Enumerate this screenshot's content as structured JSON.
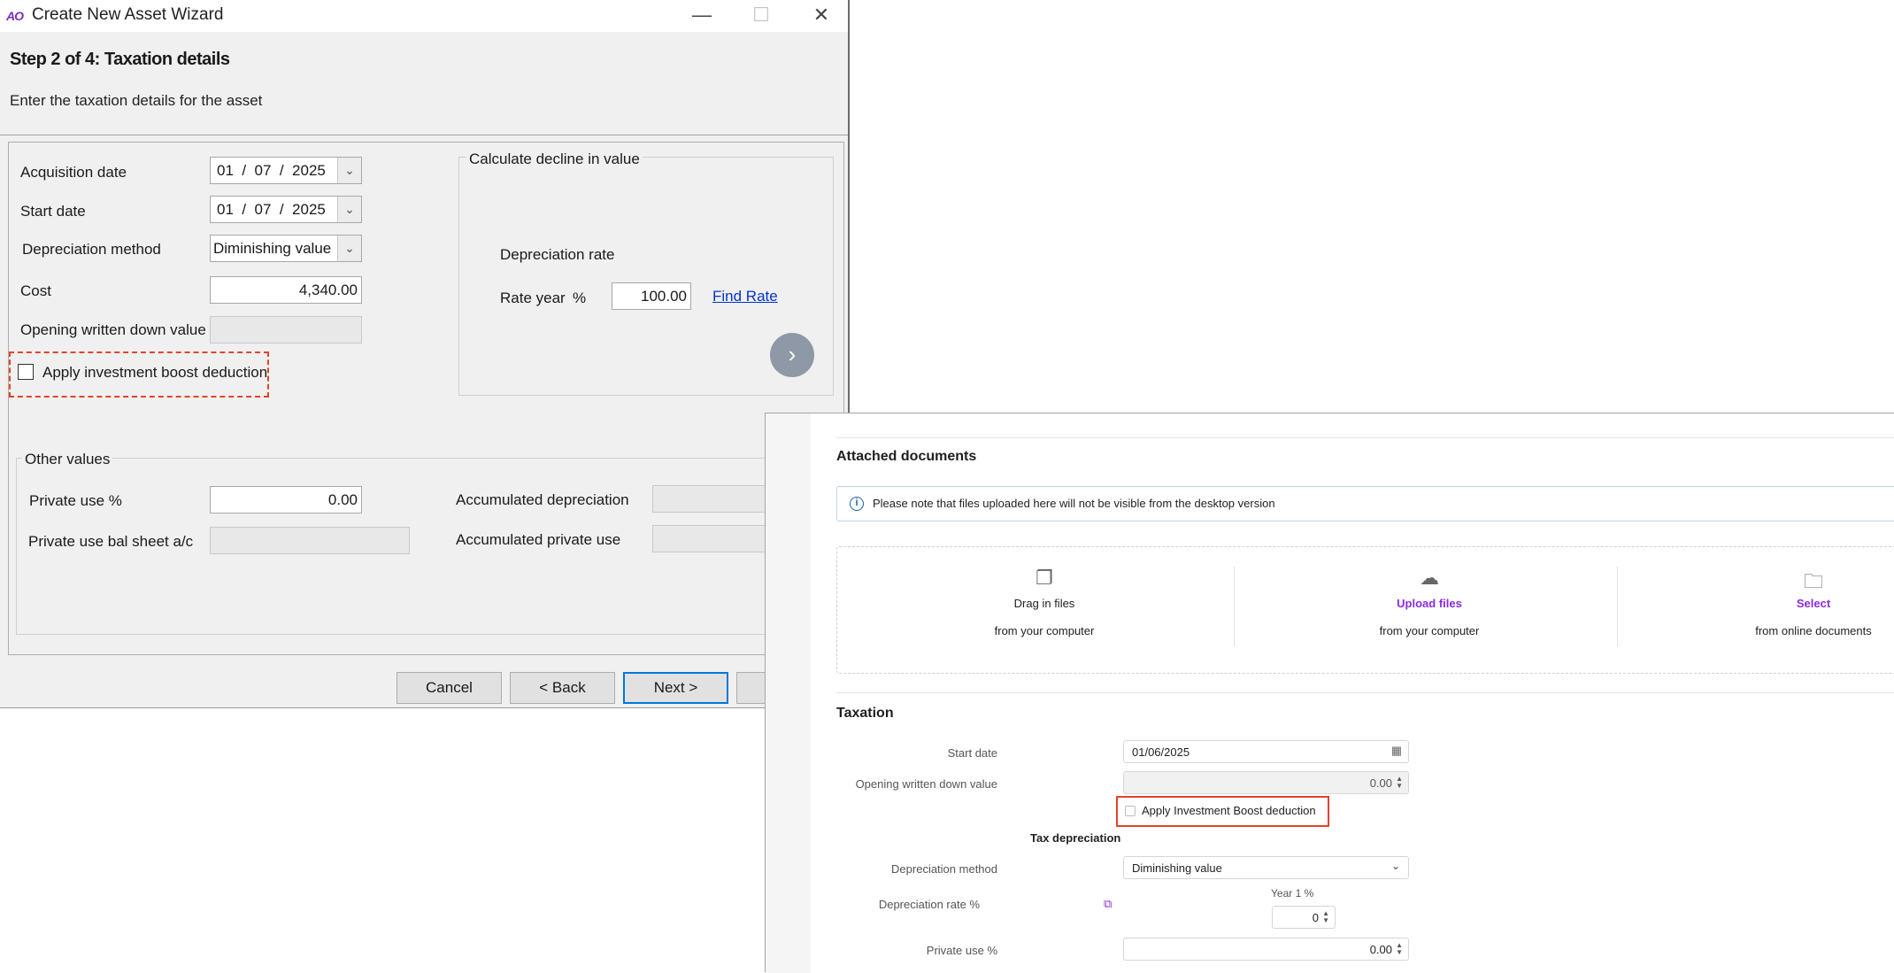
{
  "wizard": {
    "window_title": "Create New Asset Wizard",
    "logo_text": "AO",
    "controls": {
      "minimize": "—",
      "maximize": "☐",
      "close": "✕"
    },
    "step_title": "Step 2 of 4: Taxation details",
    "step_subtitle": "Enter the taxation details for the asset",
    "fields": {
      "acquisition_date": {
        "label": "Acquisition date",
        "value": "01  /  07  /  2025"
      },
      "start_date": {
        "label": "Start date",
        "value": "01  /  07  /  2025"
      },
      "depreciation_method": {
        "label": "Depreciation method",
        "value": "Diminishing value"
      },
      "cost": {
        "label": "Cost",
        "value": "4,340.00"
      },
      "opening_wdv": {
        "label": "Opening written down value",
        "value": ""
      }
    },
    "investment_boost": {
      "label": "Apply investment boost deduction",
      "checked": false
    },
    "decline_group": {
      "title": "Calculate decline in value",
      "rate_heading": "Depreciation rate",
      "rate_label": "Rate year",
      "rate_unit": "%",
      "rate_value": "100.00",
      "find_rate": "Find Rate"
    },
    "other_values": {
      "title": "Other values",
      "private_use_label": "Private use %",
      "private_use_value": "0.00",
      "private_use_bal_label": "Private use bal sheet a/c",
      "accum_depr_label": "Accumulated depreciation",
      "accum_private_label": "Accumulated private use"
    },
    "buttons": {
      "cancel": "Cancel",
      "back": "< Back",
      "next": "Next >"
    }
  },
  "web": {
    "attached": {
      "title": "Attached documents",
      "notice": "Please note that files uploaded here will not be visible from the desktop version",
      "options": [
        {
          "title": "Drag in files",
          "subtitle": "from your computer",
          "icon": "files-icon"
        },
        {
          "title": "Upload files",
          "subtitle": "from your computer",
          "icon": "cloud-upload-icon"
        },
        {
          "title": "Select",
          "subtitle": "from online documents",
          "icon": "folder-icon"
        }
      ]
    },
    "taxation": {
      "title": "Taxation",
      "start_date_label": "Start date",
      "start_date_value": "01/06/2025",
      "opening_wdv_label": "Opening written down value",
      "opening_wdv_value": "0.00",
      "investment_boost_label": "Apply Investment Boost deduction",
      "investment_boost_checked": false,
      "tax_depr_heading": "Tax depreciation",
      "depr_method_label": "Depreciation method",
      "depr_method_value": "Diminishing value",
      "depr_rate_label": "Depreciation rate %",
      "year1_label": "Year 1 %",
      "year1_value": "0",
      "private_use_label": "Private use %",
      "private_use_value": "0.00"
    }
  },
  "colors": {
    "highlight_box": "#e1442a",
    "link": "#0033cc",
    "accent_purple": "#8a2be2",
    "default_button_border": "#0078d7"
  }
}
